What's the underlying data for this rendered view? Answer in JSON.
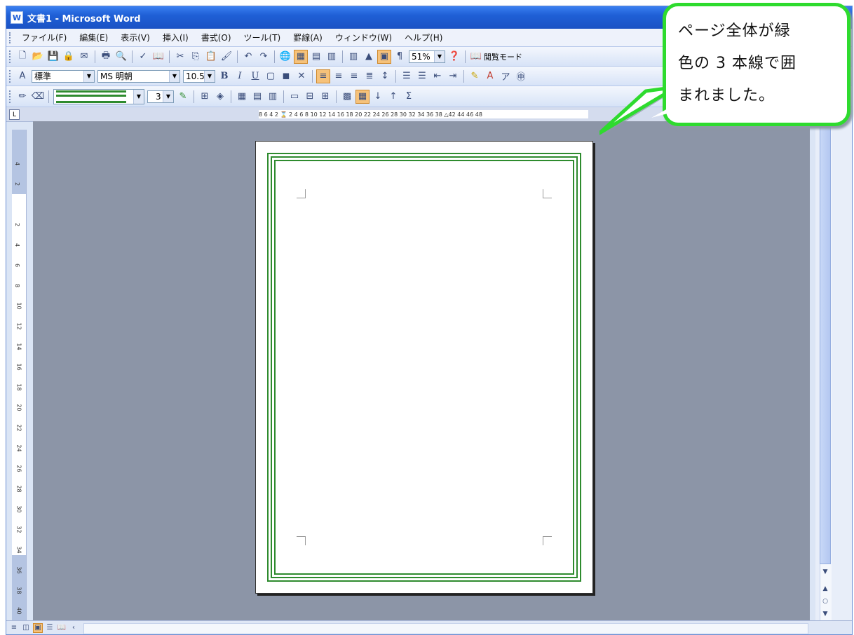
{
  "window": {
    "title": "文書1 - Microsoft Word",
    "app_icon": "W"
  },
  "menu": [
    "ファイル(F)",
    "編集(E)",
    "表示(V)",
    "挿入(I)",
    "書式(O)",
    "ツール(T)",
    "罫線(A)",
    "ウィンドウ(W)",
    "ヘルプ(H)"
  ],
  "toolbar1": {
    "zoom": "51%",
    "reading_mode": "閲覧モード"
  },
  "toolbar2": {
    "style": "標準",
    "font": "MS 明朝",
    "size": "10.5",
    "bold": "B",
    "italic": "I",
    "underline": "U"
  },
  "toolbar3": {
    "border_width": "3"
  },
  "ruler_h": {
    "text": "8 6 4 2 ⌛ 2 4 6 8 10 12 14 16 18 20 22 24 26 28 30 32 34 36 38 △42 44 46 48"
  },
  "ruler_v": {
    "marks": [
      "4",
      "2",
      "2",
      "4",
      "6",
      "8",
      "10",
      "12",
      "14",
      "16",
      "18",
      "20",
      "22",
      "24",
      "26",
      "28",
      "30",
      "32",
      "34",
      "36",
      "38",
      "40"
    ]
  },
  "callout": {
    "text_lines": [
      "ページ全体が緑",
      "色の 3 本線で囲",
      "まれました。"
    ]
  },
  "colors": {
    "border_green": "#2e8b2e",
    "callout_green": "#2edb2e",
    "title_blue": "#1f5fd6"
  }
}
